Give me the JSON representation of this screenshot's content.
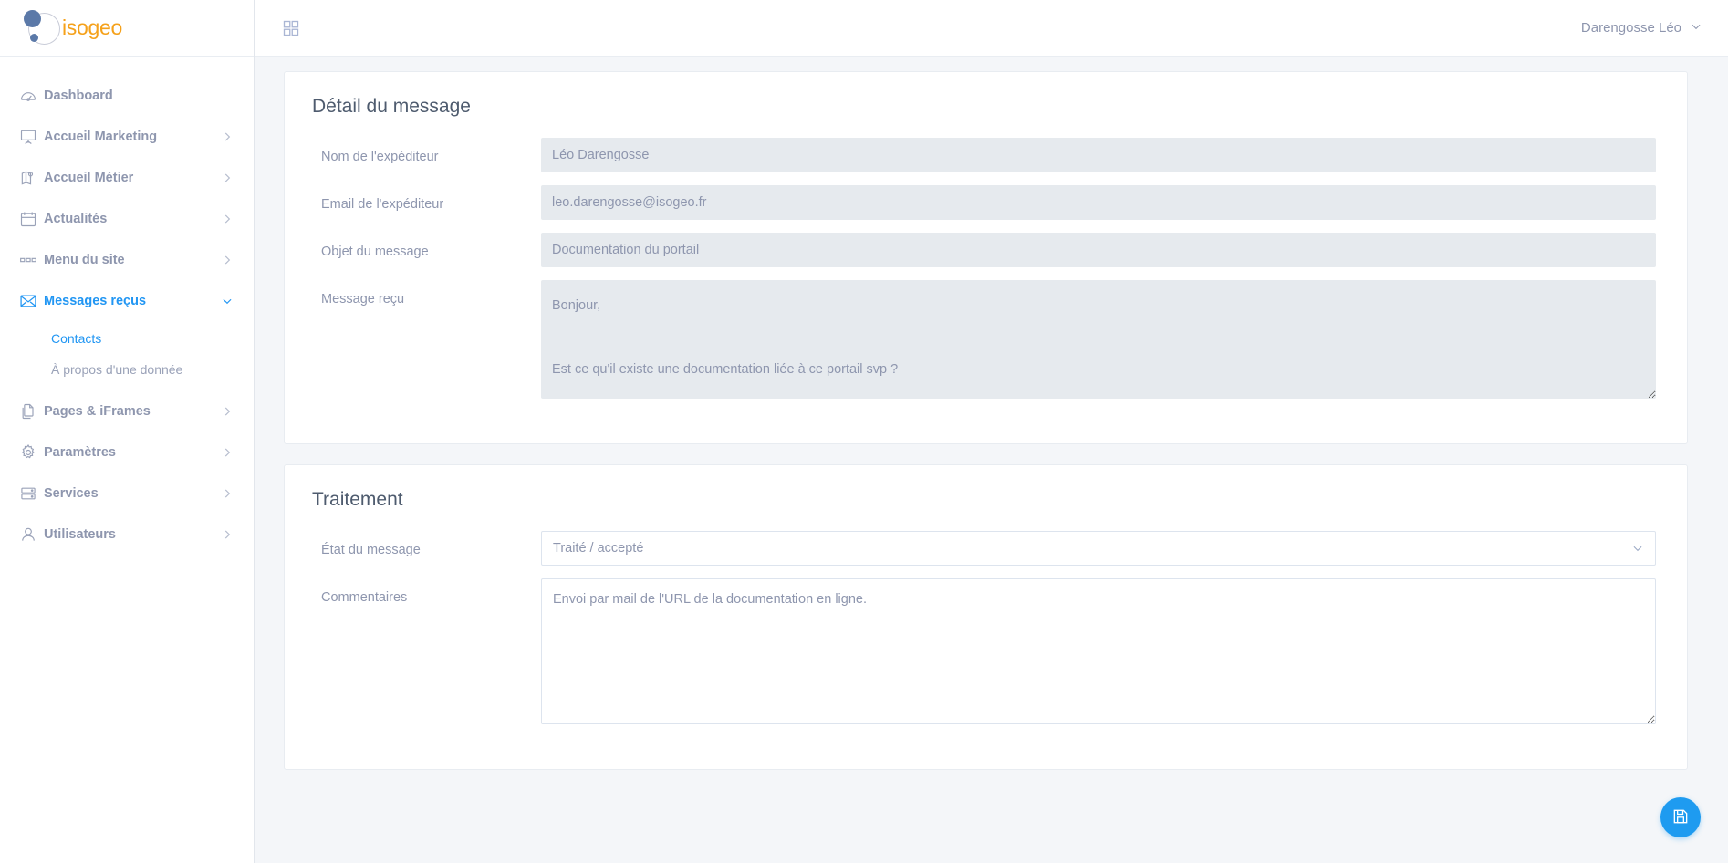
{
  "brand": {
    "name": "isogeo"
  },
  "sidebar": {
    "items": [
      {
        "label": "Dashboard",
        "icon": "gauge-icon",
        "chevron": "",
        "active": false
      },
      {
        "label": "Accueil Marketing",
        "icon": "presentation-icon",
        "chevron": "right",
        "active": false
      },
      {
        "label": "Accueil Métier",
        "icon": "map-pin-icon",
        "chevron": "right",
        "active": false
      },
      {
        "label": "Actualités",
        "icon": "calendar-icon",
        "chevron": "right",
        "active": false
      },
      {
        "label": "Menu du site",
        "icon": "menu-blocks-icon",
        "chevron": "right",
        "active": false
      },
      {
        "label": "Messages reçus",
        "icon": "envelope-icon",
        "chevron": "down",
        "active": true
      },
      {
        "label": "Pages & iFrames",
        "icon": "copy-pages-icon",
        "chevron": "right",
        "active": false
      },
      {
        "label": "Paramètres",
        "icon": "gear-icon",
        "chevron": "right",
        "active": false
      },
      {
        "label": "Services",
        "icon": "server-icon",
        "chevron": "right",
        "active": false
      },
      {
        "label": "Utilisateurs",
        "icon": "user-icon",
        "chevron": "right",
        "active": false
      }
    ],
    "submenu": [
      {
        "label": "Contacts",
        "active": true
      },
      {
        "label": "À propos d'une donnée",
        "active": false
      }
    ]
  },
  "topbar": {
    "grid_icon": "grid-apps-icon",
    "user_name": "Darengosse Léo",
    "user_chevron": "chevron-down-icon"
  },
  "detail_card": {
    "title": "Détail du message",
    "fields": {
      "sender_name_label": "Nom de l'expéditeur",
      "sender_name_value": "Léo Darengosse",
      "sender_email_label": "Email de l'expéditeur",
      "sender_email_value": "leo.darengosse@isogeo.fr",
      "subject_label": "Objet du message",
      "subject_value": "Documentation du portail",
      "message_label": "Message reçu",
      "message_value": "Bonjour,\n\nEst ce qu'il existe une documentation liée à ce portail svp ?\n\nMerci,"
    }
  },
  "treatment_card": {
    "title": "Traitement",
    "fields": {
      "state_label": "État du message",
      "state_value": "Traité / accepté",
      "comments_label": "Commentaires",
      "comments_value": "Envoi par mail de l'URL de la documentation en ligne."
    }
  },
  "save_button": {
    "icon": "save-floppy-icon",
    "title": "Enregistrer"
  },
  "colors": {
    "accent_blue": "#2196f3",
    "fab_blue": "#1e9bf0",
    "brand_orange": "#f5a11a",
    "brand_blue": "#5b79a8",
    "page_bg": "#f4f6f9",
    "readonly_bg": "#e6eaee",
    "text_muted": "#8e96ae"
  }
}
